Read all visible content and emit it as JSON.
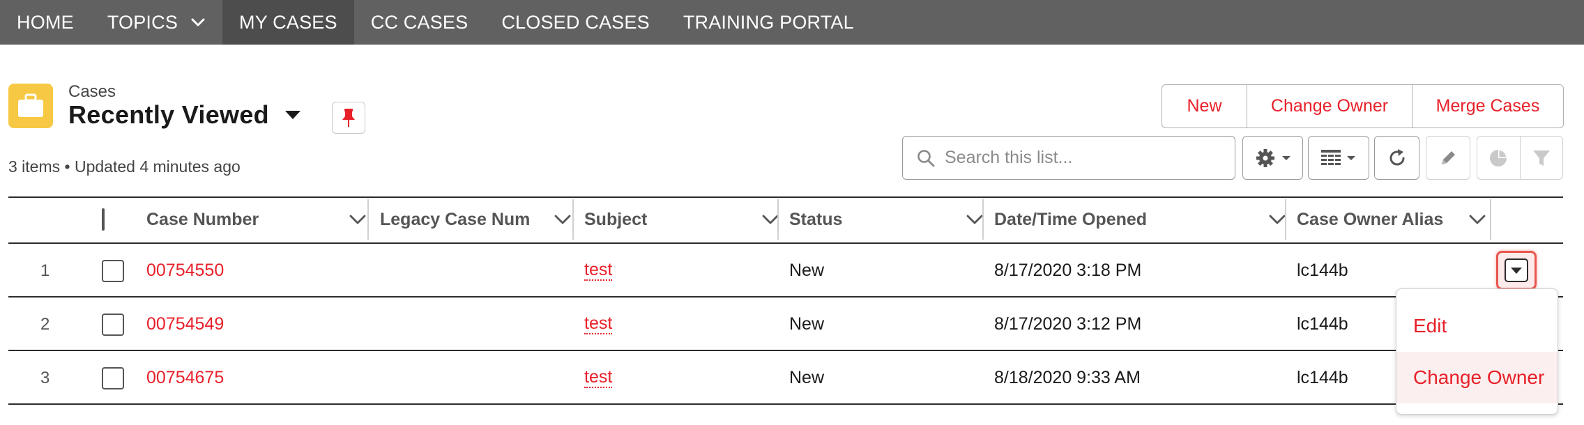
{
  "nav": {
    "items": [
      {
        "label": "HOME"
      },
      {
        "label": "TOPICS"
      },
      {
        "label": "MY CASES"
      },
      {
        "label": "CC CASES"
      },
      {
        "label": "CLOSED CASES"
      },
      {
        "label": "TRAINING PORTAL"
      }
    ],
    "active": "MY CASES"
  },
  "header": {
    "object_label": "Cases",
    "list_view": "Recently Viewed",
    "meta": "3 items • Updated 4 minutes ago"
  },
  "actions": {
    "new_label": "New",
    "change_owner_label": "Change Owner",
    "merge_label": "Merge Cases"
  },
  "search": {
    "placeholder": "Search this list...",
    "value": ""
  },
  "toolbar": {
    "icons": [
      "gear-icon",
      "table-display-icon",
      "refresh-icon",
      "pencil-icon",
      "chart-icon",
      "filter-icon"
    ]
  },
  "table": {
    "columns": [
      {
        "label": "Case Number"
      },
      {
        "label": "Legacy Case Num"
      },
      {
        "label": "Subject"
      },
      {
        "label": "Status"
      },
      {
        "label": "Date/Time Opened"
      },
      {
        "label": "Case Owner Alias"
      }
    ],
    "rows": [
      {
        "num": "1",
        "case_number": "00754550",
        "legacy": "",
        "subject": "test",
        "status": "New",
        "opened": "8/17/2020 3:18 PM",
        "owner": "lc144b"
      },
      {
        "num": "2",
        "case_number": "00754549",
        "legacy": "",
        "subject": "test",
        "status": "New",
        "opened": "8/17/2020 3:12 PM",
        "owner": "lc144b"
      },
      {
        "num": "3",
        "case_number": "00754675",
        "legacy": "",
        "subject": "test",
        "status": "New",
        "opened": "8/18/2020 9:33 AM",
        "owner": "lc144b"
      }
    ]
  },
  "row_menu": {
    "items": [
      {
        "label": "Edit"
      },
      {
        "label": "Change Owner"
      }
    ]
  },
  "colors": {
    "nav_bg": "#616161",
    "nav_active": "#4d4d4d",
    "accent": "#e8202a",
    "object_icon": "#f7c843"
  }
}
